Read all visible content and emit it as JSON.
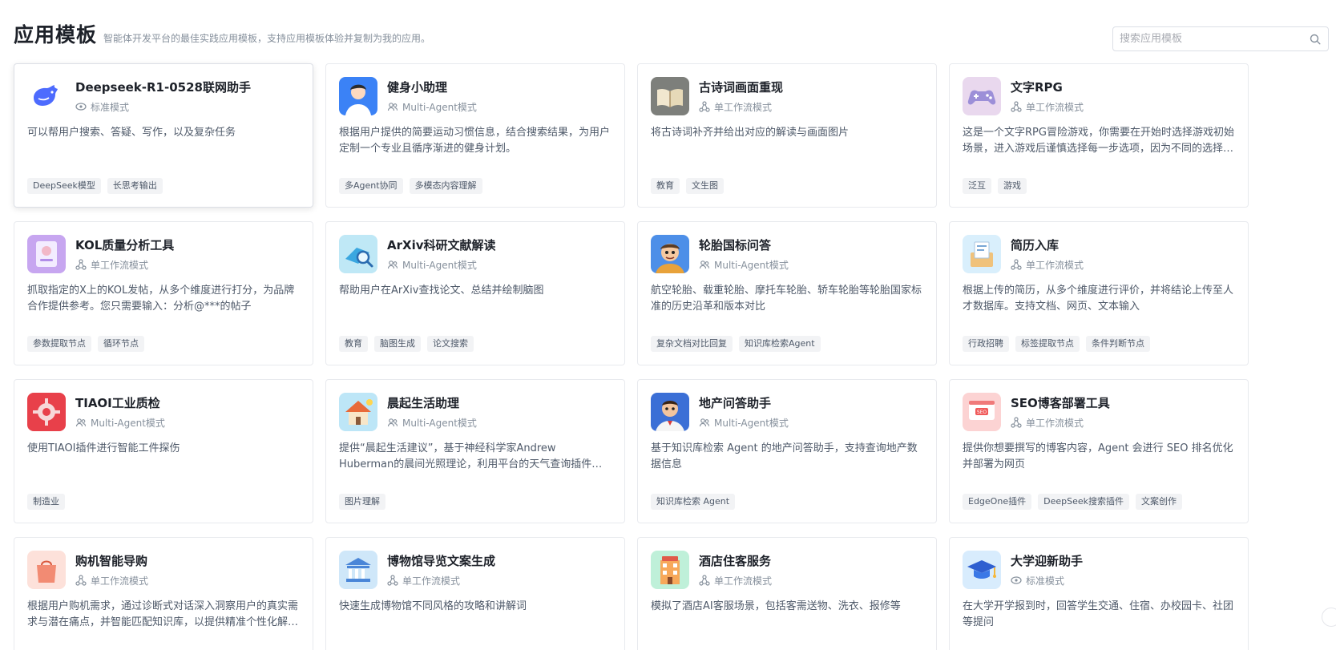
{
  "header": {
    "title": "应用模板",
    "subtitle": "智能体开发平台的最佳实践应用模板，支持应用模板体验并复制为我的应用。"
  },
  "search": {
    "placeholder": "搜索应用模板",
    "value": "",
    "icon": "search-icon"
  },
  "colors": {
    "tag_bg": "#f2f3f5",
    "border": "#e8eaee",
    "muted": "#86909c"
  },
  "cards": [
    {
      "title": "Deepseek-R1-0528联网助手",
      "mode": "标准模式",
      "mode_icon": "eye-icon",
      "avatar": "deepseek-whale",
      "desc": "可以帮用户搜索、答疑、写作，以及复杂任务",
      "tags": [
        "DeepSeek模型",
        "长思考输出"
      ],
      "active": true
    },
    {
      "title": "健身小助理",
      "mode": "Multi-Agent模式",
      "mode_icon": "users-icon",
      "avatar": "person-portrait",
      "desc": "根据用户提供的简要运动习惯信息，结合搜索结果，为用户定制一个专业且循序渐进的健身计划。",
      "tags": [
        "多Agent协同",
        "多模态内容理解"
      ]
    },
    {
      "title": "古诗词画面重现",
      "mode": "单工作流模式",
      "mode_icon": "workflow-icon",
      "avatar": "open-book",
      "desc": "将古诗词补齐并给出对应的解读与画面图片",
      "tags": [
        "教育",
        "文生图"
      ]
    },
    {
      "title": "文字RPG",
      "mode": "单工作流模式",
      "mode_icon": "workflow-icon",
      "avatar": "gamepad",
      "desc": "这是一个文字RPG冒险游戏，你需要在开始时选择游戏初始场景，进入游戏后谨慎选择每一步选项，因为不同的选择会带来不同的结局。",
      "tags": [
        "泛互",
        "游戏"
      ]
    },
    {
      "title": "KOL质量分析工具",
      "mode": "单工作流模式",
      "mode_icon": "workflow-icon",
      "avatar": "profile-card",
      "desc": "抓取指定的X上的KOL发帖，从多个维度进行打分，为品牌合作提供参考。您只需要输入：分析@***的帖子",
      "tags": [
        "参数提取节点",
        "循环节点"
      ]
    },
    {
      "title": "ArXiv科研文献解读",
      "mode": "Multi-Agent模式",
      "mode_icon": "users-icon",
      "avatar": "book-magnifier",
      "desc": "帮助用户在ArXiv查找论文、总结并绘制脑图",
      "tags": [
        "教育",
        "脑图生成",
        "论文搜索"
      ]
    },
    {
      "title": "轮胎国标问答",
      "mode": "Multi-Agent模式",
      "mode_icon": "users-icon",
      "avatar": "cartoon-driver",
      "desc": "航空轮胎、载重轮胎、摩托车轮胎、轿车轮胎等轮胎国家标准的历史沿革和版本对比",
      "tags": [
        "复杂文档对比回复",
        "知识库检索Agent"
      ]
    },
    {
      "title": "简历入库",
      "mode": "单工作流模式",
      "mode_icon": "workflow-icon",
      "avatar": "resume-box",
      "desc": "根据上传的简历，从多个维度进行评价，并将结论上传至人才数据库。支持文档、网页、文本输入",
      "tags": [
        "行政招聘",
        "标签提取节点",
        "条件判断节点"
      ]
    },
    {
      "title": "TIAOI工业质检",
      "mode": "Multi-Agent模式",
      "mode_icon": "users-icon",
      "avatar": "gear",
      "desc": "使用TIAOI插件进行智能工件探伤",
      "tags": [
        "制造业"
      ]
    },
    {
      "title": "晨起生活助理",
      "mode": "Multi-Agent模式",
      "mode_icon": "users-icon",
      "avatar": "house",
      "desc": "提供“晨起生活建议”，基于神经科学家Andrew Huberman的晨间光照理论，利用平台的天气查询插件、日出日落插件等为用户提供建议。",
      "tags": [
        "图片理解"
      ]
    },
    {
      "title": "地产问答助手",
      "mode": "Multi-Agent模式",
      "mode_icon": "users-icon",
      "avatar": "cartoon-agent",
      "desc": "基于知识库检索 Agent 的地产问答助手，支持查询地产数据信息",
      "tags": [
        "知识库检索 Agent"
      ]
    },
    {
      "title": "SEO博客部署工具",
      "mode": "单工作流模式",
      "mode_icon": "workflow-icon",
      "avatar": "seo-window",
      "desc": "提供你想要撰写的博客内容，Agent 会进行 SEO 排名优化并部署为网页",
      "tags": [
        "EdgeOne插件",
        "DeepSeek搜索插件",
        "文案创作"
      ]
    },
    {
      "title": "购机智能导购",
      "mode": "单工作流模式",
      "mode_icon": "workflow-icon",
      "avatar": "shopping-bag",
      "desc": "根据用户购机需求，通过诊断式对话深入洞察用户的真实需求与潜在痛点，并智能匹配知识库，以提供精准个性化解决方案。",
      "tags": []
    },
    {
      "title": "博物馆导览文案生成",
      "mode": "单工作流模式",
      "mode_icon": "workflow-icon",
      "avatar": "museum",
      "desc": "快速生成博物馆不同风格的攻略和讲解词",
      "tags": []
    },
    {
      "title": "酒店住客服务",
      "mode": "单工作流模式",
      "mode_icon": "workflow-icon",
      "avatar": "hotel",
      "desc": "模拟了酒店AI客服场景，包括客需送物、洗衣、报修等",
      "tags": []
    },
    {
      "title": "大学迎新助手",
      "mode": "标准模式",
      "mode_icon": "eye-icon",
      "avatar": "graduation-cap",
      "desc": "在大学开学报到时，回答学生交通、住宿、办校园卡、社团等提问",
      "tags": []
    }
  ]
}
